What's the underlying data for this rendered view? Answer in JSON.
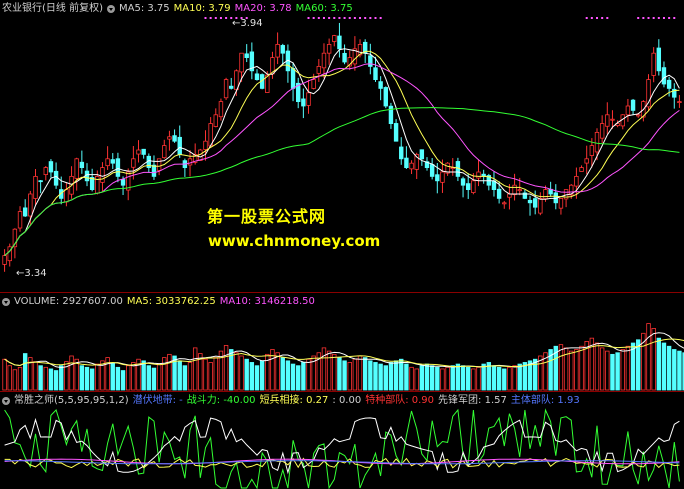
{
  "price_header": {
    "title": "农业银行(日线 前复权)",
    "ma5": "MA5: 3.75",
    "ma10": "MA10: 3.79",
    "ma20": "MA20: 3.78",
    "ma60": "MA60: 3.75"
  },
  "price_annotations": {
    "high": "3.94",
    "low": "3.34"
  },
  "watermark": {
    "line1": "第一股票公式网",
    "line2": "www.chnmoney.com"
  },
  "volume_header": {
    "volume": "VOLUME: 2927607.00",
    "ma5": "MA5: 3033762.25",
    "ma10": "MA10: 3146218.50"
  },
  "indicator_header": {
    "name": "常胜之师(5,5,95,95,1,2)",
    "qianfu": "潜伏地带: -",
    "zhandouli": "战斗力: -40.00",
    "duanbing": "短兵相接: 0.27",
    "zero": ": 0.00",
    "tezhong": "特种部队: 0.90",
    "xianfeng": "先锋军团: 1.57",
    "zhuli": "主体部队: 1.93"
  },
  "colors": {
    "up": "#ff3333",
    "down": "#55ffff",
    "ma5": "#ffffff",
    "ma10": "#ffff55",
    "ma20": "#ff55ff",
    "ma60": "#33ff33",
    "grid": "#8a0000"
  },
  "chart_data": [
    {
      "type": "candlestick",
      "title": "农业银行(日线 前复权)",
      "ylim": [
        3.34,
        3.94
      ],
      "series": [
        {
          "name": "MA5",
          "last": 3.75
        },
        {
          "name": "MA10",
          "last": 3.79
        },
        {
          "name": "MA20",
          "last": 3.78
        },
        {
          "name": "MA60",
          "last": 3.75
        }
      ],
      "close": [
        3.4,
        3.42,
        3.46,
        3.5,
        3.49,
        3.54,
        3.58,
        3.57,
        3.6,
        3.59,
        3.56,
        3.53,
        3.55,
        3.58,
        3.62,
        3.6,
        3.57,
        3.55,
        3.58,
        3.6,
        3.62,
        3.61,
        3.58,
        3.56,
        3.59,
        3.62,
        3.64,
        3.63,
        3.6,
        3.58,
        3.62,
        3.65,
        3.67,
        3.66,
        3.63,
        3.6,
        3.62,
        3.63,
        3.64,
        3.66,
        3.7,
        3.72,
        3.75,
        3.8,
        3.78,
        3.82,
        3.86,
        3.85,
        3.82,
        3.8,
        3.78,
        3.81,
        3.85,
        3.88,
        3.86,
        3.82,
        3.78,
        3.75,
        3.74,
        3.77,
        3.8,
        3.83,
        3.86,
        3.88,
        3.9,
        3.87,
        3.84,
        3.85,
        3.87,
        3.88,
        3.86,
        3.83,
        3.8,
        3.78,
        3.74,
        3.7,
        3.66,
        3.62,
        3.6,
        3.61,
        3.63,
        3.62,
        3.6,
        3.58,
        3.57,
        3.59,
        3.61,
        3.6,
        3.58,
        3.56,
        3.55,
        3.57,
        3.59,
        3.58,
        3.56,
        3.55,
        3.53,
        3.52,
        3.54,
        3.56,
        3.55,
        3.53,
        3.52,
        3.51,
        3.53,
        3.55,
        3.54,
        3.52,
        3.53,
        3.55,
        3.56,
        3.58,
        3.6,
        3.62,
        3.65,
        3.68,
        3.7,
        3.72,
        3.71,
        3.7,
        3.72,
        3.74,
        3.73,
        3.72,
        3.75,
        3.8,
        3.86,
        3.82,
        3.79,
        3.78,
        3.76,
        3.75
      ]
    },
    {
      "type": "bar",
      "title": "VOLUME",
      "series": [
        {
          "name": "VOLUME",
          "last": 2927607.0
        },
        {
          "name": "MA5",
          "last": 3033762.25
        },
        {
          "name": "MA10",
          "last": 3146218.5
        }
      ],
      "values": [
        38,
        30,
        25,
        28,
        45,
        40,
        35,
        30,
        28,
        26,
        24,
        30,
        35,
        42,
        38,
        30,
        28,
        26,
        32,
        36,
        40,
        33,
        28,
        24,
        30,
        34,
        38,
        36,
        30,
        27,
        32,
        40,
        44,
        42,
        36,
        30,
        34,
        52,
        45,
        38,
        34,
        40,
        48,
        55,
        50,
        46,
        42,
        38,
        34,
        30,
        36,
        44,
        50,
        46,
        40,
        36,
        32,
        30,
        34,
        38,
        42,
        46,
        52,
        48,
        44,
        40,
        36,
        34,
        38,
        42,
        40,
        36,
        34,
        32,
        30,
        34,
        36,
        38,
        32,
        28,
        26,
        30,
        32,
        30,
        28,
        26,
        28,
        30,
        32,
        30,
        28,
        26,
        28,
        32,
        34,
        30,
        28,
        26,
        28,
        30,
        32,
        34,
        36,
        38,
        42,
        46,
        50,
        54,
        56,
        52,
        48,
        50,
        54,
        60,
        64,
        58,
        52,
        48,
        44,
        46,
        50,
        54,
        58,
        62,
        70,
        82,
        76,
        64,
        58,
        54,
        50,
        48,
        46,
        44
      ],
      "ylim": [
        0,
        100
      ]
    },
    {
      "type": "line",
      "title": "常胜之师(5,5,95,95,1,2)",
      "series": [
        {
          "name": "潜伏地带",
          "last": null
        },
        {
          "name": "战斗力",
          "last": -40.0
        },
        {
          "name": "短兵相接",
          "last": 0.27
        },
        {
          "name": "特种部队",
          "last": 0.9
        },
        {
          "name": "先锋军团",
          "last": 1.57
        },
        {
          "name": "主体部队",
          "last": 1.93
        }
      ]
    }
  ]
}
